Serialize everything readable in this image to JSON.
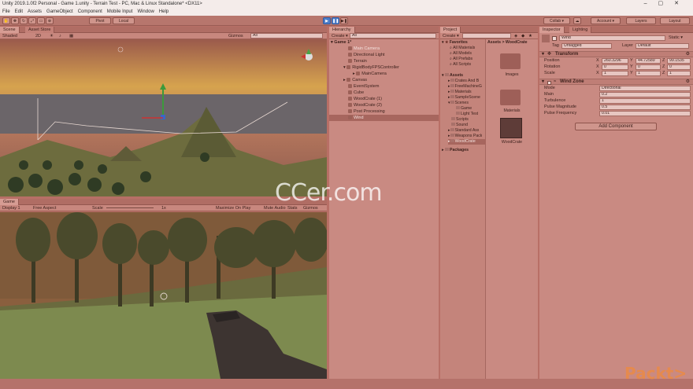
{
  "window": {
    "title": "Unity 2019.1.0f2 Personal - Game 1.unity - Terrain Test - PC, Mac & Linux Standalone* <DX11>"
  },
  "menu": [
    "File",
    "Edit",
    "Assets",
    "GameObject",
    "Component",
    "Mobile Input",
    "Window",
    "Help"
  ],
  "toolbar": {
    "pivot": "Pivot",
    "local": "Local",
    "collab": "Collab ▾",
    "account": "Account ▾",
    "layers": "Layers",
    "layout": "Layout"
  },
  "scene_panel": {
    "tabs": [
      "Scene",
      "Asset Store"
    ],
    "shading": "Shaded",
    "gizmos": "Gizmos",
    "search_placeholder": "All"
  },
  "game_panel": {
    "tab": "Game",
    "display": "Display 1",
    "aspect": "Free Aspect",
    "scale_label": "Scale",
    "scale_value": "1x",
    "maximize": "Maximize On Play",
    "mute": "Mute Audio",
    "stats": "Stats",
    "gizmos": "Gizmos"
  },
  "hierarchy": {
    "tab": "Hierarchy",
    "create": "Create ▾",
    "search_placeholder": "All",
    "scene": "Game 1*",
    "items": [
      "Main Camera",
      "Directional Light",
      "Terrain",
      "RigidBodyFPSController",
      "MainCamera",
      "Canvas",
      "EventSystem",
      "Cube",
      "WoodCrate (1)",
      "WoodCrate (2)",
      "Post Processing",
      "Wind"
    ]
  },
  "project": {
    "tab": "Project",
    "create": "Create ▾",
    "breadcrumb": "Assets > WoodCrate",
    "favorites": "Favorites",
    "favorite_items": [
      "All Materials",
      "All Models",
      "All Prefabs",
      "All Scripts"
    ],
    "assets": "Assets",
    "asset_items": [
      "Crates And B",
      "FreeMachineG",
      "Materials",
      "SampleScene",
      "Scenes",
      "Game",
      "Light Test",
      "Scripts",
      "Sound",
      "Standard Ass",
      "Weapons Pack",
      "WoodCrate"
    ],
    "packages": "Packages",
    "grid_items": [
      "Images",
      "Materials",
      "WoodCrate"
    ]
  },
  "inspector": {
    "tabs": [
      "Inspector",
      "Lighting"
    ],
    "object_name": "Wind",
    "static_label": "Static ▾",
    "tag_label": "Tag",
    "tag_value": "Untagged",
    "layer_label": "Layer",
    "layer_value": "Default",
    "transform": {
      "title": "Transform",
      "rows": [
        {
          "label": "Position",
          "x": "260.3296",
          "y": "44.72589",
          "z": "99.1535"
        },
        {
          "label": "Rotation",
          "x": "0",
          "y": "0",
          "z": "0"
        },
        {
          "label": "Scale",
          "x": "1",
          "y": "1",
          "z": "1"
        }
      ]
    },
    "windzone": {
      "title": "Wind Zone",
      "rows": [
        {
          "label": "Mode",
          "value": "Directional"
        },
        {
          "label": "Main",
          "value": "0.2"
        },
        {
          "label": "Turbulence",
          "value": "1"
        },
        {
          "label": "Pulse Magnitude",
          "value": "0.5"
        },
        {
          "label": "Pulse Frequency",
          "value": "0.01"
        }
      ]
    },
    "add_component": "Add Component"
  },
  "watermark": "CCer.com",
  "brand_logo": "Packt>",
  "colors": {
    "tint": "#b86f66",
    "play_button": "#4e7ec9",
    "brand": "#e58a4e"
  }
}
